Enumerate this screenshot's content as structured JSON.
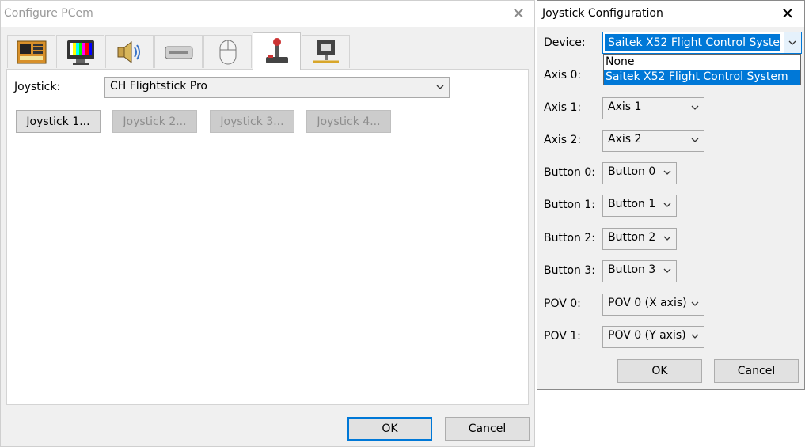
{
  "configure_window": {
    "title": "Configure PCem",
    "close_glyph": "✕",
    "tabs": [
      {
        "icon": "motherboard-icon"
      },
      {
        "icon": "display-icon"
      },
      {
        "icon": "speaker-icon"
      },
      {
        "icon": "drive-icon"
      },
      {
        "icon": "mouse-icon"
      },
      {
        "icon": "joystick-icon",
        "active": true
      },
      {
        "icon": "network-icon"
      }
    ],
    "joystick_label": "Joystick:",
    "joystick_value": "CH Flightstick Pro",
    "joystick_buttons": [
      "Joystick 1...",
      "Joystick 2...",
      "Joystick 3...",
      "Joystick 4..."
    ],
    "ok_label": "OK",
    "cancel_label": "Cancel"
  },
  "joystick_config_window": {
    "title": "Joystick Configuration",
    "close_glyph": "✕",
    "device_label": "Device:",
    "device_value": "Saitek X52 Flight Control System",
    "device_options": [
      "None",
      "Saitek X52 Flight Control System"
    ],
    "rows": [
      {
        "label": "Axis 0:",
        "value": ""
      },
      {
        "label": "Axis 1:",
        "value": "Axis 1"
      },
      {
        "label": "Axis 2:",
        "value": "Axis 2"
      },
      {
        "label": "Button 0:",
        "value": "Button 0"
      },
      {
        "label": "Button 1:",
        "value": "Button 1"
      },
      {
        "label": "Button 2:",
        "value": "Button 2"
      },
      {
        "label": "Button 3:",
        "value": "Button 3"
      },
      {
        "label": "POV 0:",
        "value": "POV 0 (X axis)"
      },
      {
        "label": "POV 1:",
        "value": "POV 0 (Y axis)"
      }
    ],
    "ok_label": "OK",
    "cancel_label": "Cancel"
  },
  "colors": {
    "accent": "#0078d7",
    "window_bg": "#f0f0f0"
  }
}
